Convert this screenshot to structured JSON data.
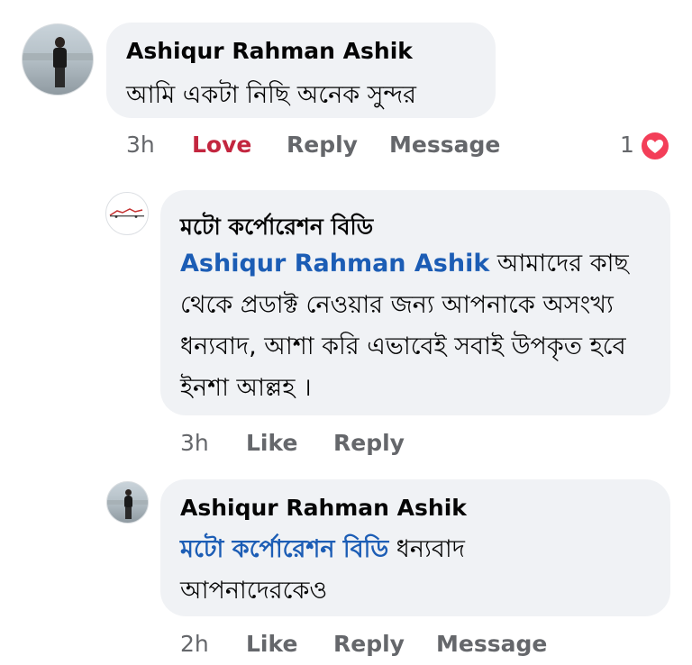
{
  "comments": [
    {
      "author": "Ashiqur Rahman Ashik",
      "text": "আমি একটা নিছি অনেক সুন্দর",
      "time": "3h",
      "reaction_label": "Love",
      "reply_label": "Reply",
      "message_label": "Message",
      "reaction_count": "1",
      "reaction_icon": "heart-icon",
      "reaction_color": "#f33e58"
    },
    {
      "author": "মটো কর্পোরেশন বিডি",
      "mention": "Ashiqur Rahman Ashik",
      "text": " আমাদের কাছ থেকে প্রডাক্ট নেওয়ার জন্য আপনাকে অসংখ্য ধন্যবাদ, আশা করি এভাবেই সবাই উপকৃত হবে ইনশা আল্লহ ।",
      "time": "3h",
      "like_label": "Like",
      "reply_label": "Reply"
    },
    {
      "author": "Ashiqur Rahman Ashik",
      "mention": "মটো কর্পোরেশন বিডি",
      "text": "  ধন্যবাদ আপনাদেরকেও",
      "time": "2h",
      "like_label": "Like",
      "reply_label": "Reply",
      "message_label": "Message"
    }
  ],
  "colors": {
    "bubble": "#f0f2f5",
    "mention": "#1c5db5",
    "love": "#c3263f",
    "meta": "#65676b"
  }
}
